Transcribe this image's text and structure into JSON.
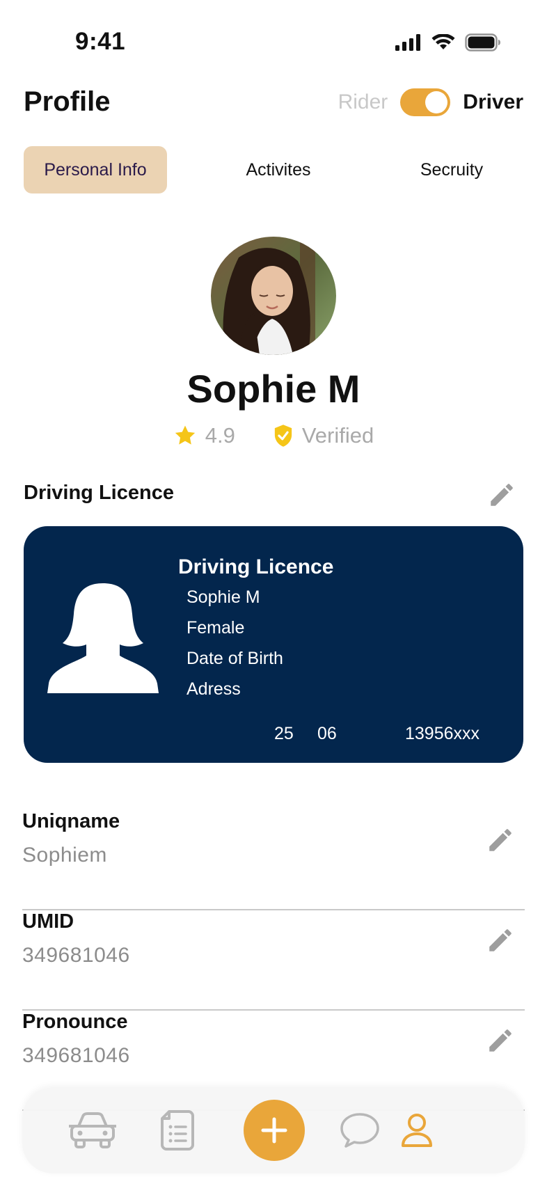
{
  "status_bar": {
    "time": "9:41"
  },
  "header": {
    "title": "Profile",
    "mode_left": "Rider",
    "mode_right": "Driver",
    "driver_mode_on": true
  },
  "tabs": [
    {
      "label": "Personal Info",
      "active": true
    },
    {
      "label": "Activites",
      "active": false
    },
    {
      "label": "Secruity",
      "active": false
    }
  ],
  "profile": {
    "name": "Sophie M",
    "rating": "4.9",
    "verified_label": "Verified"
  },
  "driving_licence": {
    "section_title": "Driving Licence",
    "card_title": "Driving Licence",
    "name": "Sophie M",
    "gender": "Female",
    "dob_label": "Date of Birth",
    "address_label": "Adress",
    "footer_day": "25",
    "footer_month": "06",
    "footer_number": "13956xxx"
  },
  "fields": [
    {
      "label": "Uniqname",
      "value": "Sophiem"
    },
    {
      "label": "UMID",
      "value": "349681046"
    },
    {
      "label": "Pronounce",
      "value": "349681046"
    }
  ],
  "colors": {
    "accent": "#e9a63a",
    "tab_active_bg": "#ebd3b3",
    "card_bg": "#03264d",
    "star": "#f5c518"
  },
  "nav": {
    "items": [
      "car-icon",
      "document-list-icon",
      "add-icon",
      "chat-bubble-icon",
      "profile-icon"
    ],
    "active": "profile-icon"
  }
}
